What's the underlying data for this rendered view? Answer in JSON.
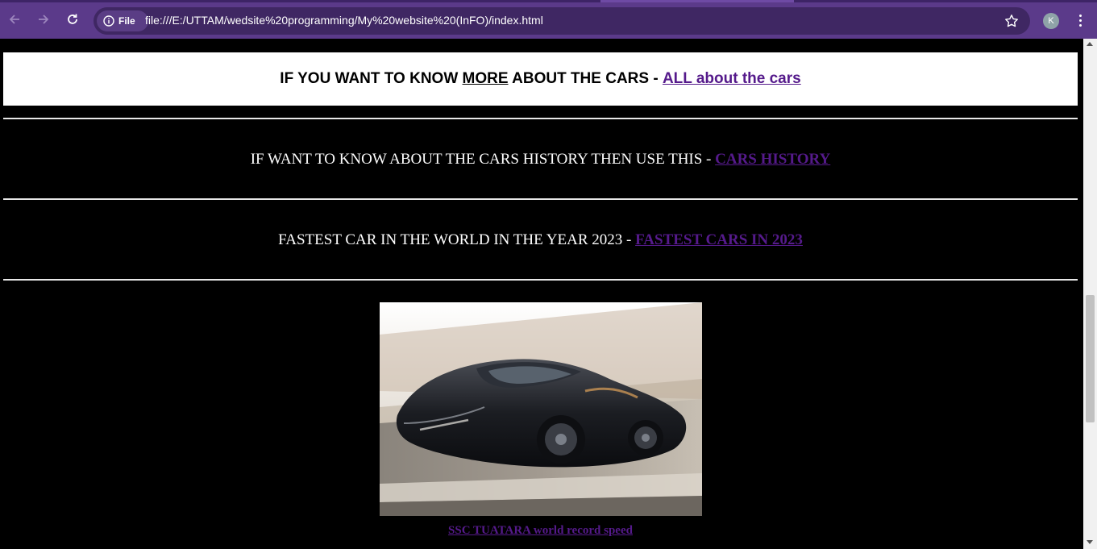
{
  "browser": {
    "site_chip_label": "File",
    "url": "file:///E:/UTTAM/wedsite%20programming/My%20website%20(InFO)/index.html",
    "profile_initial": "K",
    "icons": [
      "back-arrow-icon",
      "forward-arrow-icon",
      "reload-icon",
      "info-icon",
      "star-icon",
      "kebab-menu-icon"
    ],
    "colors": {
      "chrome": "#5b3a8a",
      "omnibox": "#3f2763"
    }
  },
  "page": {
    "banner": {
      "prefix": "IF YOU WANT TO KNOW ",
      "emphasis": "MORE",
      "suffix": " ABOUT THE CARS - ",
      "link": "ALL about the cars"
    },
    "history": {
      "text": "IF WANT TO KNOW ABOUT THE CARS HISTORY THEN USE THIS - ",
      "link": "CARS HISTORY"
    },
    "fastest": {
      "text": "FASTEST CAR IN THE WORLD IN THE YEAR 2023 - ",
      "link": "FASTEST CARS IN 2023"
    },
    "car_image": {
      "alt": "SSC TUATARA"
    },
    "caption_link": "SSC TUATARA world record speed",
    "colors": {
      "background": "#000000",
      "text": "#ffffff",
      "link_visited": "#551a8b"
    }
  }
}
